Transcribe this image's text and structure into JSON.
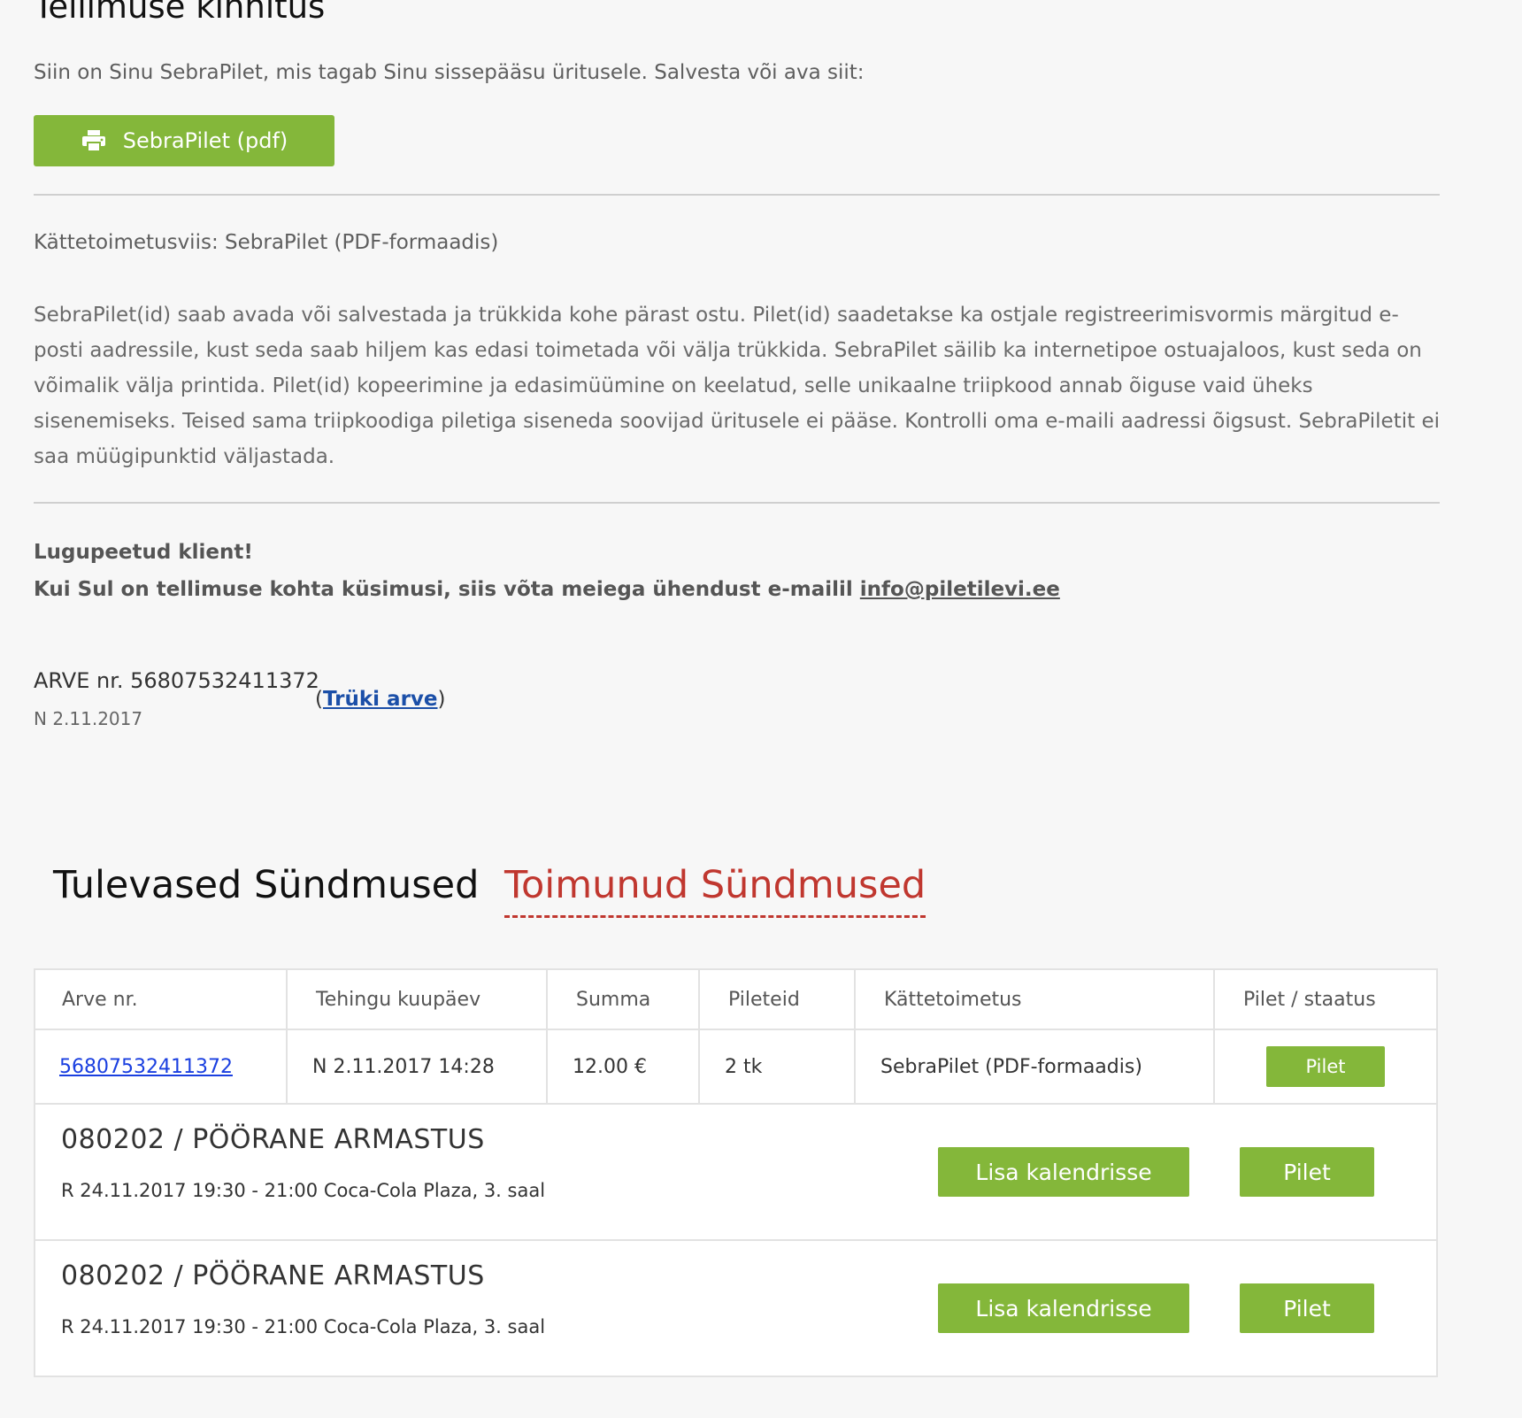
{
  "page": {
    "title": "Tellimuse kinnitus",
    "intro": "Siin on Sinu SebraPilet, mis tagab Sinu sissepääsu üritusele. Salvesta või ava siit:",
    "pdf_button_label": "SebraPilet (pdf)",
    "pdf_button_icon": "printer-icon"
  },
  "delivery": {
    "method_text": "Kättetoimetusviis: SebraPilet (PDF-formaadis)",
    "paragraph": "SebraPilet(id) saab avada või salvestada ja trükkida kohe pärast ostu. Pilet(id) saadetakse ka ostjale registreerimisvormis märgitud e-posti aadressile, kust seda saab hiljem kas edasi toimetada või välja trükkida. SebraPilet säilib ka internetipoe ostuajaloos, kust seda on võimalik välja printida. Pilet(id) kopeerimine ja edasimüümine on keelatud, selle unikaalne triipkood annab õiguse vaid üheks sisenemiseks. Teised sama triipkoodiga piletiga siseneda soovijad üritusele ei pääse. Kontrolli oma e-maili aadressi õigsust. SebraPiletit ei saa müügipunktid väljastada."
  },
  "contact": {
    "greeting": "Lugupeetud klient!",
    "text": "Kui Sul on tellimuse kohta küsimusi, siis võta meiega ühendust e-mailil ",
    "email": "info@piletilevi.ee"
  },
  "invoice": {
    "number_text": "ARVE nr. 56807532411372",
    "date": "N 2.11.2017",
    "print_open": "(",
    "print_label": "Trüki arve",
    "print_close": ")"
  },
  "tabs": {
    "upcoming": "Tulevased Sündmused",
    "past": "Toimunud Sündmused"
  },
  "table": {
    "headers": [
      "Arve nr.",
      "Tehingu kuupäev",
      "Summa",
      "Pileteid",
      "Kättetoimetus",
      "Pilet / staatus"
    ],
    "row": {
      "invoice": "56807532411372",
      "date": "N 2.11.2017 14:28",
      "sum": "12.00 €",
      "tickets": "2 tk",
      "delivery": "SebraPilet (PDF-formaadis)",
      "ticket_button": "Pilet"
    },
    "events": [
      {
        "title": "080202 / PÖÖRANE ARMASTUS",
        "details": "R 24.11.2017 19:30 - 21:00 Coca-Cola Plaza, 3. saal",
        "calendar_button": "Lisa kalendrisse",
        "ticket_button": "Pilet"
      },
      {
        "title": "080202 / PÖÖRANE ARMASTUS",
        "details": "R 24.11.2017 19:30 - 21:00 Coca-Cola Plaza, 3. saal",
        "calendar_button": "Lisa kalendrisse",
        "ticket_button": "Pilet"
      }
    ]
  },
  "colors": {
    "accent_green": "#84b73a",
    "active_tab_red": "#c0372f",
    "link_blue": "#1b4fa8",
    "background": "#f7f7f7"
  }
}
